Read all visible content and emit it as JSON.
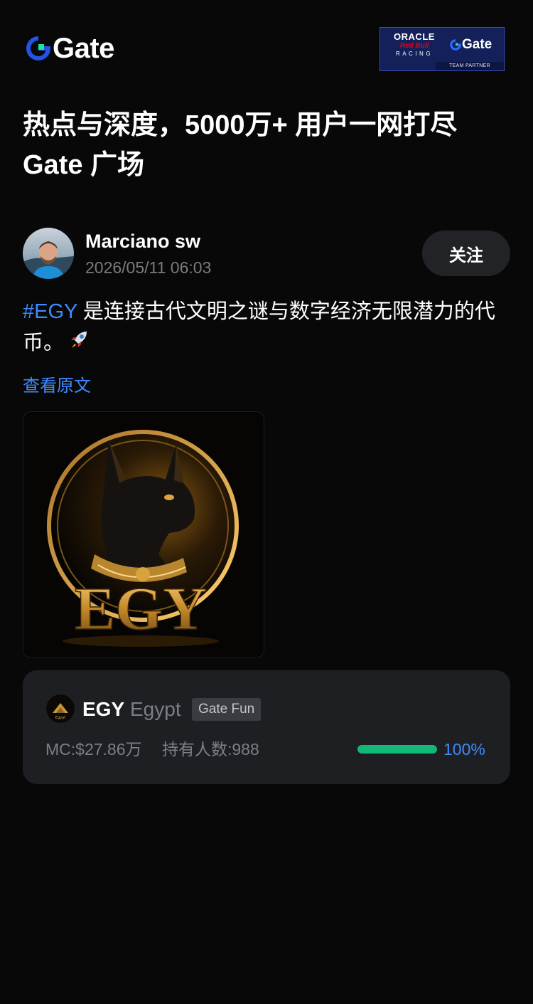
{
  "header": {
    "logo_text": "Gate",
    "partner": {
      "oracle": "ORACLE",
      "redbull": "Red Bull",
      "racing": "RACING",
      "gate": "Gate",
      "tag": "TEAM PARTNER"
    }
  },
  "headline": {
    "line1": "热点与深度，5000万+ 用户一网打尽",
    "line2": "Gate 广场"
  },
  "post": {
    "author_name": "Marciano sw",
    "time": "2026/05/11 06:03",
    "follow_label": "关注",
    "hashtag": "#EGY",
    "text": " 是连接古代文明之谜与数字经济无限潜力的代币。",
    "view_original_label": "查看原文",
    "image_text": "EGY"
  },
  "token": {
    "symbol": "EGY",
    "name": "Egypt",
    "badge": "Gate Fun",
    "market_cap": "MC:$27.86万",
    "holders": "持有人数:988",
    "progress_fraction": 1.0,
    "progress_label": "100%",
    "icon_text": "Egypt"
  },
  "colors": {
    "accent_blue": "#3e8bff",
    "progress_green": "#12b878",
    "background": "#080808",
    "card": "#1d1f23"
  }
}
